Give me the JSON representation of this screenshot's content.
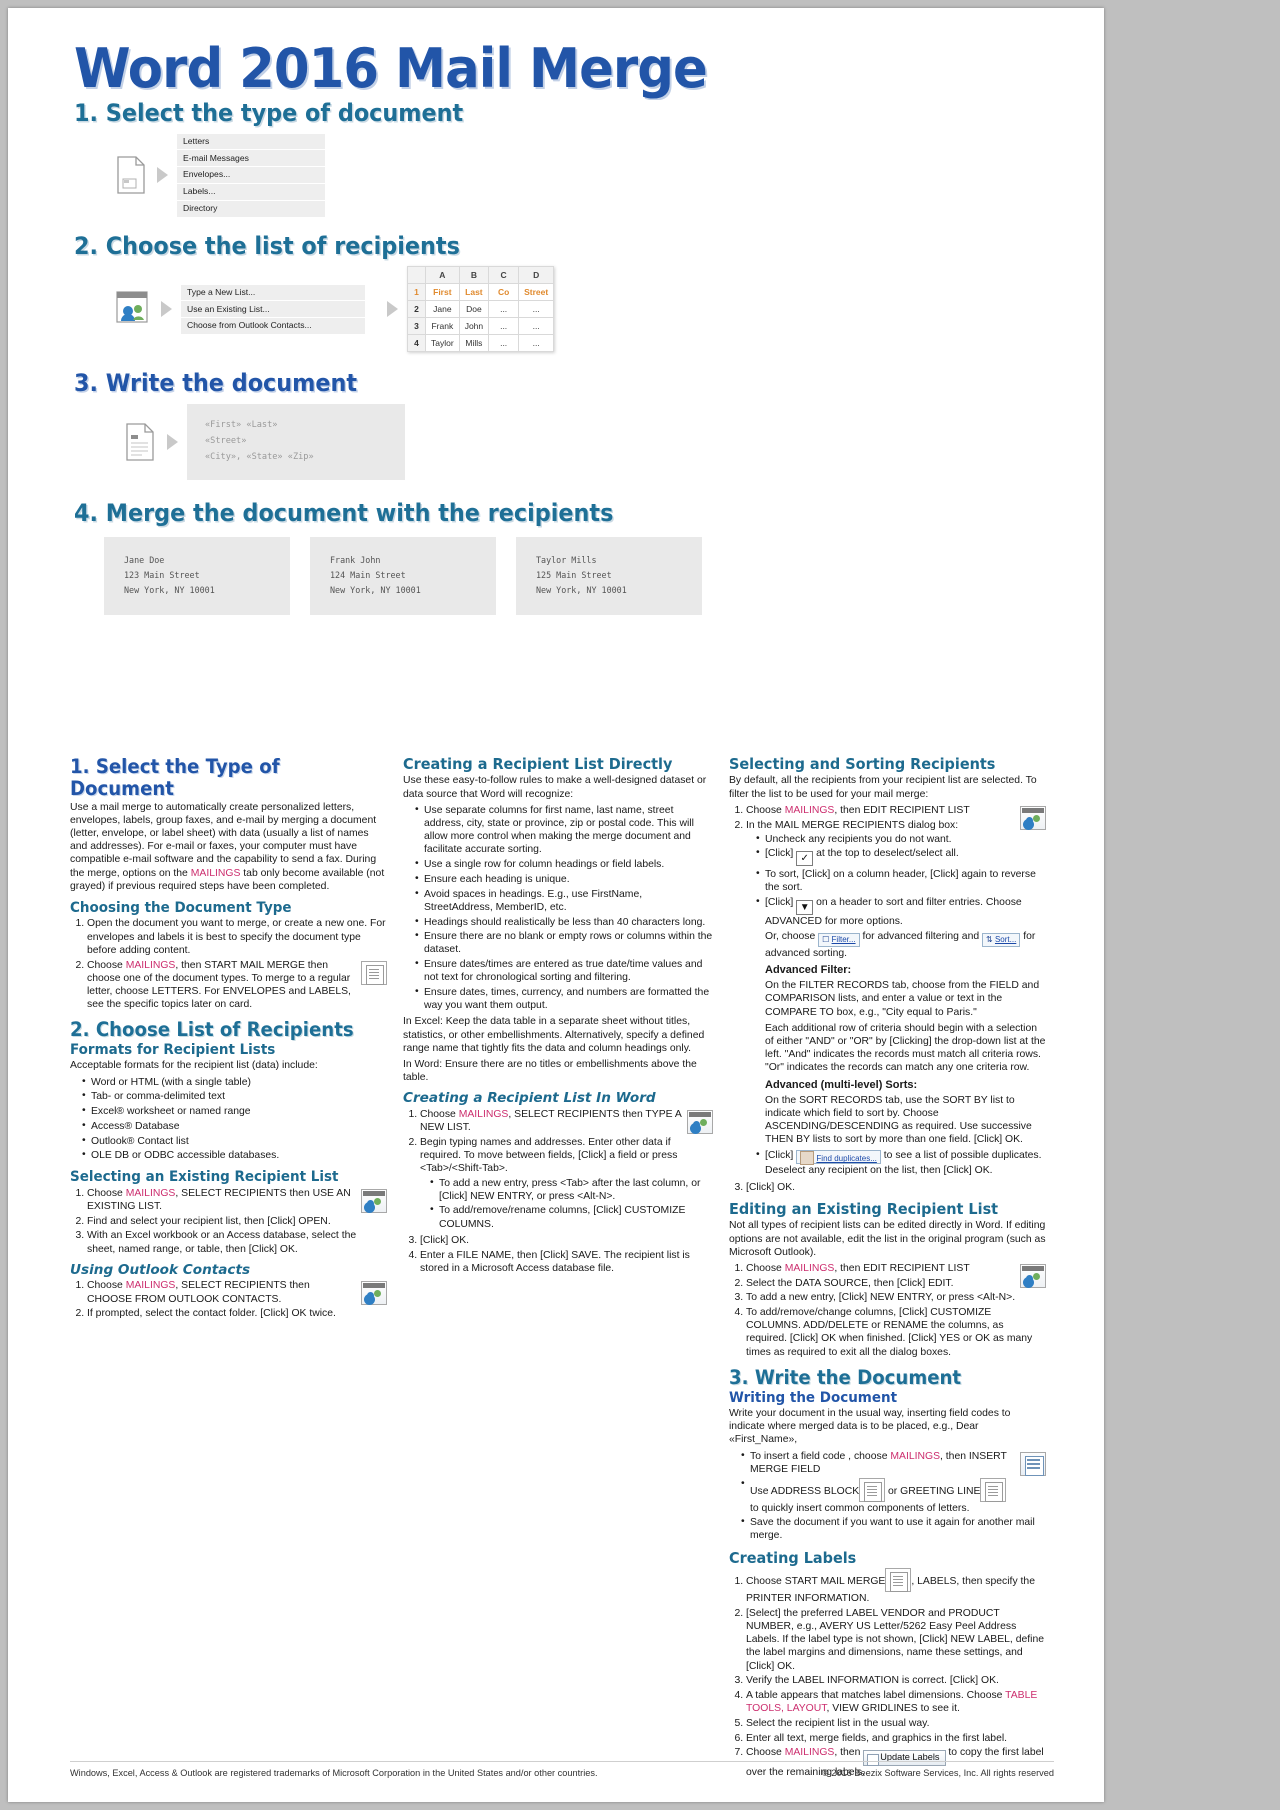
{
  "title": "Word 2016 Mail Merge",
  "colors": {
    "title_blue": "#2255a8",
    "heading_teal": "#1e6f96",
    "mailings_pink": "#cc2e6e",
    "orange": "#e08a2e"
  },
  "quickref": {
    "step1": {
      "heading": "1. Select the type of document",
      "icon": "document-icon",
      "menu": [
        "Letters",
        "E-mail Messages",
        "Envelopes...",
        "Labels...",
        "Directory"
      ]
    },
    "step2": {
      "heading": "2. Choose the list of recipients",
      "icon": "select-recipients-icon",
      "menu": [
        "Type a New List...",
        "Use an Existing List...",
        "Choose from Outlook Contacts..."
      ],
      "sheet": {
        "columns": [
          "",
          "A",
          "B",
          "C",
          "D"
        ],
        "rows": [
          [
            "1",
            "First",
            "Last",
            "Co",
            "Street"
          ],
          [
            "2",
            "Jane",
            "Doe",
            "...",
            "..."
          ],
          [
            "3",
            "Frank",
            "John",
            "...",
            "..."
          ],
          [
            "4",
            "Taylor",
            "Mills",
            "...",
            "..."
          ]
        ]
      }
    },
    "step3": {
      "heading": "3. Write the document",
      "icon": "write-document-icon",
      "code": [
        "«First» «Last»",
        "«Street»",
        "«City», «State» «Zip»"
      ]
    },
    "step4": {
      "heading": "4. Merge the document with the recipients",
      "letters": [
        [
          "Jane Doe",
          "123 Main Street",
          "New York, NY 10001"
        ],
        [
          "Frank John",
          "124 Main Street",
          "New York, NY 10001"
        ],
        [
          "Taylor Mills",
          "125 Main Street",
          "New York, NY 10001"
        ]
      ]
    }
  },
  "col1": {
    "h_select_type": "1. Select the Type of Document",
    "p_intro_a": "Use a mail merge to automatically create personalized letters, envelopes, labels, group faxes, and e-mail by merging a document (letter, envelope, or label sheet) with data (usually a list of names and addresses). For e-mail or faxes, your computer must have compatible e-mail software and the capability to send a fax. During the merge, options on the ",
    "p_intro_mailings": "MAILINGS",
    "p_intro_b": " tab only become available (not grayed) if previous required steps have been completed.",
    "h_choosing": "Choosing the Document Type",
    "choosing_1": "Open the document you want to merge, or create a new one. For envelopes and labels it is best to specify the document type before adding content.",
    "choosing_2a": "Choose ",
    "choosing_2_mailings": "MAILINGS",
    "choosing_2b": ", then START MAIL MERGE",
    "choosing_2c": " then choose one of the document types. To merge to a regular letter, choose LETTERS. For ENVELOPES and LABELS, see the specific topics later on card.",
    "h_choose_list": "2. Choose List of Recipients",
    "h_formats": "Formats for Recipient Lists",
    "p_formats": "Acceptable formats for the recipient list (data) include:",
    "formats": [
      "Word or HTML (with a single table)",
      "Tab- or comma-delimited text",
      "Excel® worksheet or named range",
      "Access® Database",
      "Outlook® Contact list",
      "OLE DB or ODBC accessible databases."
    ],
    "h_selecting": "Selecting an Existing Recipient List",
    "sel_1a": "Choose ",
    "sel_1_mailings": "MAILINGS",
    "sel_1b": ", SELECT RECIPIENTS",
    "sel_1c": " then USE AN EXISTING LIST.",
    "sel_2": "Find and select your recipient list, then [Click] OPEN.",
    "sel_3": "With an Excel workbook or an Access database, select the sheet, named range, or table, then [Click] OK.",
    "h_outlook": "Using Outlook Contacts",
    "out_1a": "Choose ",
    "out_1_mailings": "MAILINGS",
    "out_1b": ", SELECT RECIPIENTS",
    "out_1c": " then CHOOSE FROM OUTLOOK CONTACTS.",
    "out_2": "If prompted, select the contact folder. [Click] OK twice."
  },
  "col2": {
    "h_directly": "Creating a Recipient List Directly",
    "p_directly": "Use these easy-to-follow rules to make a well-designed dataset or data source that Word will recognize:",
    "rules": [
      "Use separate columns for first name, last name, street address, city, state or province, zip or postal code. This will allow more control when making the merge document and facilitate accurate sorting.",
      "Use a single row for column headings or field labels.",
      "Ensure each heading is unique.",
      "Avoid spaces in headings. E.g., use FirstName, StreetAddress, MemberID, etc.",
      "Headings should realistically be less than 40 characters long.",
      "Ensure there are no blank or empty rows or columns within the dataset.",
      "Ensure dates/times are entered as true date/time values and not text for chronological sorting and filtering.",
      "Ensure dates, times, currency, and numbers are formatted the way you want them output."
    ],
    "p_excel": "In Excel: Keep the data table in a separate sheet without titles, statistics, or other embellishments. Alternatively, specify a defined range name that tightly fits the data and column headings only.",
    "p_word": "In Word: Ensure there are no titles or embellishments above the table.",
    "h_inword": "Creating a Recipient List In Word",
    "inword_1a": "Choose ",
    "inword_1_mailings": "MAILINGS",
    "inword_1b": ", SELECT RECIPIENTS",
    "inword_1c": " then TYPE A NEW LIST.",
    "inword_2": "Begin typing names and addresses. Enter other data if required. To move between fields, [Click] a field or press <Tab>/<Shift-Tab>.",
    "inword_2_sub": [
      "To add a new entry, press <Tab> after the last column, or [Click] NEW ENTRY, or press <Alt-N>.",
      "To add/remove/rename columns, [Click] CUSTOMIZE COLUMNS."
    ],
    "inword_3": "[Click] OK.",
    "inword_4": "Enter a FILE NAME, then [Click] SAVE. The recipient list is stored in a Microsoft Access database file."
  },
  "col3": {
    "h_selsort": "Selecting and Sorting Recipients",
    "p_selsort": "By default, all the recipients from your recipient list are selected. To filter the list to be used for your mail merge:",
    "s1a": "Choose ",
    "s1_mailings": "MAILINGS",
    "s1b": ", then EDIT RECIPIENT LIST",
    "s2": "In the MAIL MERGE RECIPIENTS dialog box:",
    "s2_bullets": {
      "b1": "Uncheck any recipients you do not want.",
      "b2a": "[Click] ",
      "b2_icon": "checkbox-checked-icon",
      "b2b": " at the top to deselect/select all.",
      "b3": "To sort, [Click] on a column header, [Click] again to reverse the sort.",
      "b4a": "[Click] ",
      "b4_icon": "dropdown-arrow-icon",
      "b4b": " on a header to sort and filter entries. Choose ADVANCED for more options."
    },
    "or_choose_a": "Or, choose ",
    "filter_btn": "Filter...",
    "or_choose_b": " for advanced filtering and ",
    "sort_btn": "Sort...",
    "or_choose_c": " for advanced sorting.",
    "h_advfilter": "Advanced Filter:",
    "p_advfilter_1": "On the FILTER RECORDS tab, choose from the FIELD and COMPARISON lists, and enter a value or text in the COMPARE TO box, e.g., \"City equal to Paris.\"",
    "p_advfilter_2": "Each additional row of criteria should begin with a selection of either \"AND\" or \"OR\" by [Clicking] the drop-down list at the left. \"And\" indicates the records must match all criteria rows. \"Or\" indicates the records can match any one criteria row.",
    "h_advsort": "Advanced (multi-level) Sorts:",
    "p_advsort": "On the SORT RECORDS tab, use the SORT BY list to indicate which field to sort by. Choose ASCENDING/DESCENDING as required. Use successive THEN BY lists to sort by more than one field. [Click] OK.",
    "dup_a": "[Click] ",
    "dup_btn": "Find duplicates...",
    "dup_b": " to see a list of possible duplicates. Deselect any recipient on the list, then [Click] OK.",
    "s3": "[Click] OK.",
    "h_editing": "Editing an Existing Recipient List",
    "p_editing": "Not all types of recipient lists can be edited directly in Word. If editing options are not available, edit the list in the original program (such as Microsoft Outlook).",
    "ed_1a": "Choose ",
    "ed_1_mailings": "MAILINGS",
    "ed_1b": ", then EDIT RECIPIENT LIST",
    "ed_2": "Select the DATA SOURCE, then [Click] EDIT.",
    "ed_3": "To add a new entry, [Click] NEW ENTRY, or press <Alt-N>.",
    "ed_4": "To add/remove/change columns, [Click] CUSTOMIZE COLUMNS. ADD/DELETE or RENAME the columns, as required. [Click] OK when finished. [Click] YES or OK as many times as required to exit all the dialog boxes.",
    "h_write": "3. Write the Document",
    "h_writing": "Writing the Document",
    "p_writing": "Write your document in the usual way, inserting field codes to indicate where merged data is to be placed, e.g., Dear «First_Name»,",
    "w_b1a": "To insert a field code , choose ",
    "w_b1_mailings": "MAILINGS",
    "w_b1b": ", then INSERT MERGE FIELD",
    "w_b2a": "Use ADDRESS BLOCK",
    "w_b2b": " or GREETING LINE",
    "w_b2c": " to quickly insert common components of letters.",
    "w_b3": "Save the document if you want to use it again for another mail merge.",
    "h_labels": "Creating Labels",
    "lb_1a": "Choose START MAIL MERGE",
    "lb_1b": ", LABELS, then specify the PRINTER INFORMATION.",
    "lb_2": "[Select] the preferred LABEL VENDOR and PRODUCT NUMBER, e.g., AVERY US Letter/5262 Easy Peel Address Labels. If the label type is not shown, [Click] NEW LABEL, define the label margins and dimensions, name these settings, and [Click] OK.",
    "lb_3": "Verify the LABEL INFORMATION is correct. [Click] OK.",
    "lb_4a": "A table appears that matches label dimensions. Choose ",
    "lb_4_red": "TABLE TOOLS, LAYOUT",
    "lb_4b": ", VIEW GRIDLINES to see it.",
    "lb_5": "Select the recipient list in the usual way.",
    "lb_6": "Enter all text, merge fields, and graphics in the first label.",
    "lb_7a": "Choose ",
    "lb_7_mailings": "MAILINGS",
    "lb_7b": ", then ",
    "lb_7_btn": "Update Labels",
    "lb_7c": " to copy the first label over the remaining labels."
  },
  "footer": {
    "left": "Windows, Excel, Access & Outlook are registered trademarks of Microsoft Corporation in the United States and/or other countries.",
    "right": "© 2016 Beezix Software Services, Inc. All rights reserved"
  }
}
